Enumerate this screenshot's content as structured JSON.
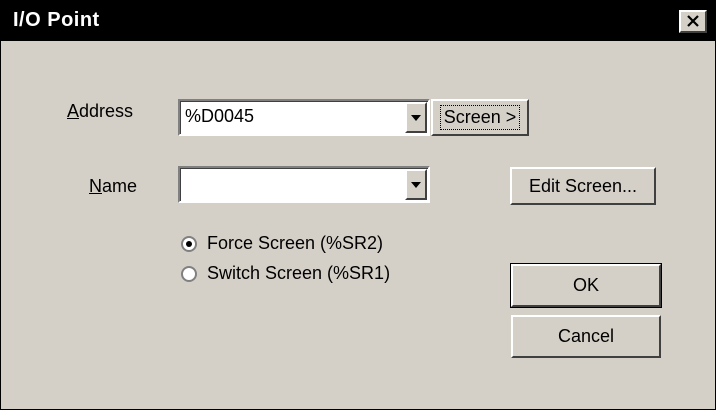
{
  "window": {
    "title": "I/O Point",
    "close_icon": "close-icon"
  },
  "address": {
    "label_prefix": "",
    "label_underlined": "A",
    "label_rest": "ddress",
    "value": "%D0045",
    "screen_button": "Screen >"
  },
  "name": {
    "label_underlined": "N",
    "label_rest": "ame",
    "value": ""
  },
  "edit_screen_button": "Edit Screen...",
  "radios": {
    "force": {
      "label": "Force Screen (%SR2)",
      "checked": true
    },
    "switch": {
      "label": "Switch Screen (%SR1)",
      "checked": false
    }
  },
  "buttons": {
    "ok": "OK",
    "cancel": "Cancel"
  },
  "colors": {
    "titlebar": "#000000",
    "face": "#d4d0c8"
  }
}
